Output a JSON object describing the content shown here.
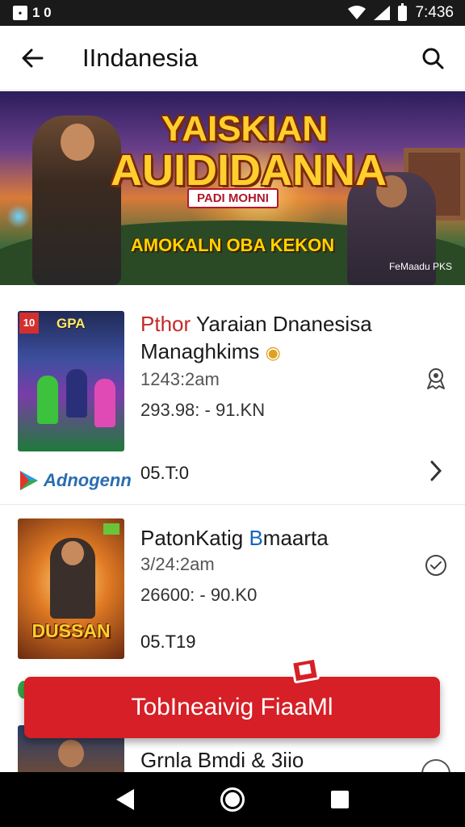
{
  "status_bar": {
    "left_icon": "notification-icon",
    "left_box": "•",
    "left_text": "1 0",
    "time": "7:436",
    "icons": [
      "wifi-icon",
      "signal-icon",
      "battery-icon"
    ]
  },
  "app_bar": {
    "title": "IIndanesia",
    "back_icon": "arrow-left-icon",
    "search_icon": "search-icon"
  },
  "banner": {
    "line1": "YAISKIAN",
    "line2": "AUIDIDANNA",
    "tag": "PADI MOHNI",
    "tagline": "AMOKALN OBA KEKON",
    "corner": "FeMaadu PKS"
  },
  "items": [
    {
      "thumb_badge": "10",
      "thumb_label": "GPA",
      "title_red": "Pthor",
      "title_rest": " Yaraian Dnanesisa",
      "title_line2": "Managhkims",
      "meta": "1243:2am",
      "stats": "293.98: - 91.KN",
      "code": "05.T:0",
      "brand": "Adnogenn",
      "side_icon": "award-icon",
      "chevron": "chevron-right-icon"
    },
    {
      "thumb_logo": "DUSSAN",
      "title_a": "PatonKatig ",
      "title_b": "B",
      "title_c": "maarta",
      "meta": "3/24:2am",
      "stats": "26600: - 90.K0",
      "code": "05.T19",
      "side_icon": "check-circle-icon"
    },
    {
      "title": "Grnla Bmdi & 3iio",
      "side_icon": "circle-icon"
    }
  ],
  "cta": {
    "label": "TobIneaivig FiaaMl",
    "tag_icon": "tag-icon"
  },
  "nav_bar": {
    "back": "nav-back-icon",
    "home": "nav-home-icon",
    "recent": "nav-recent-icon"
  }
}
